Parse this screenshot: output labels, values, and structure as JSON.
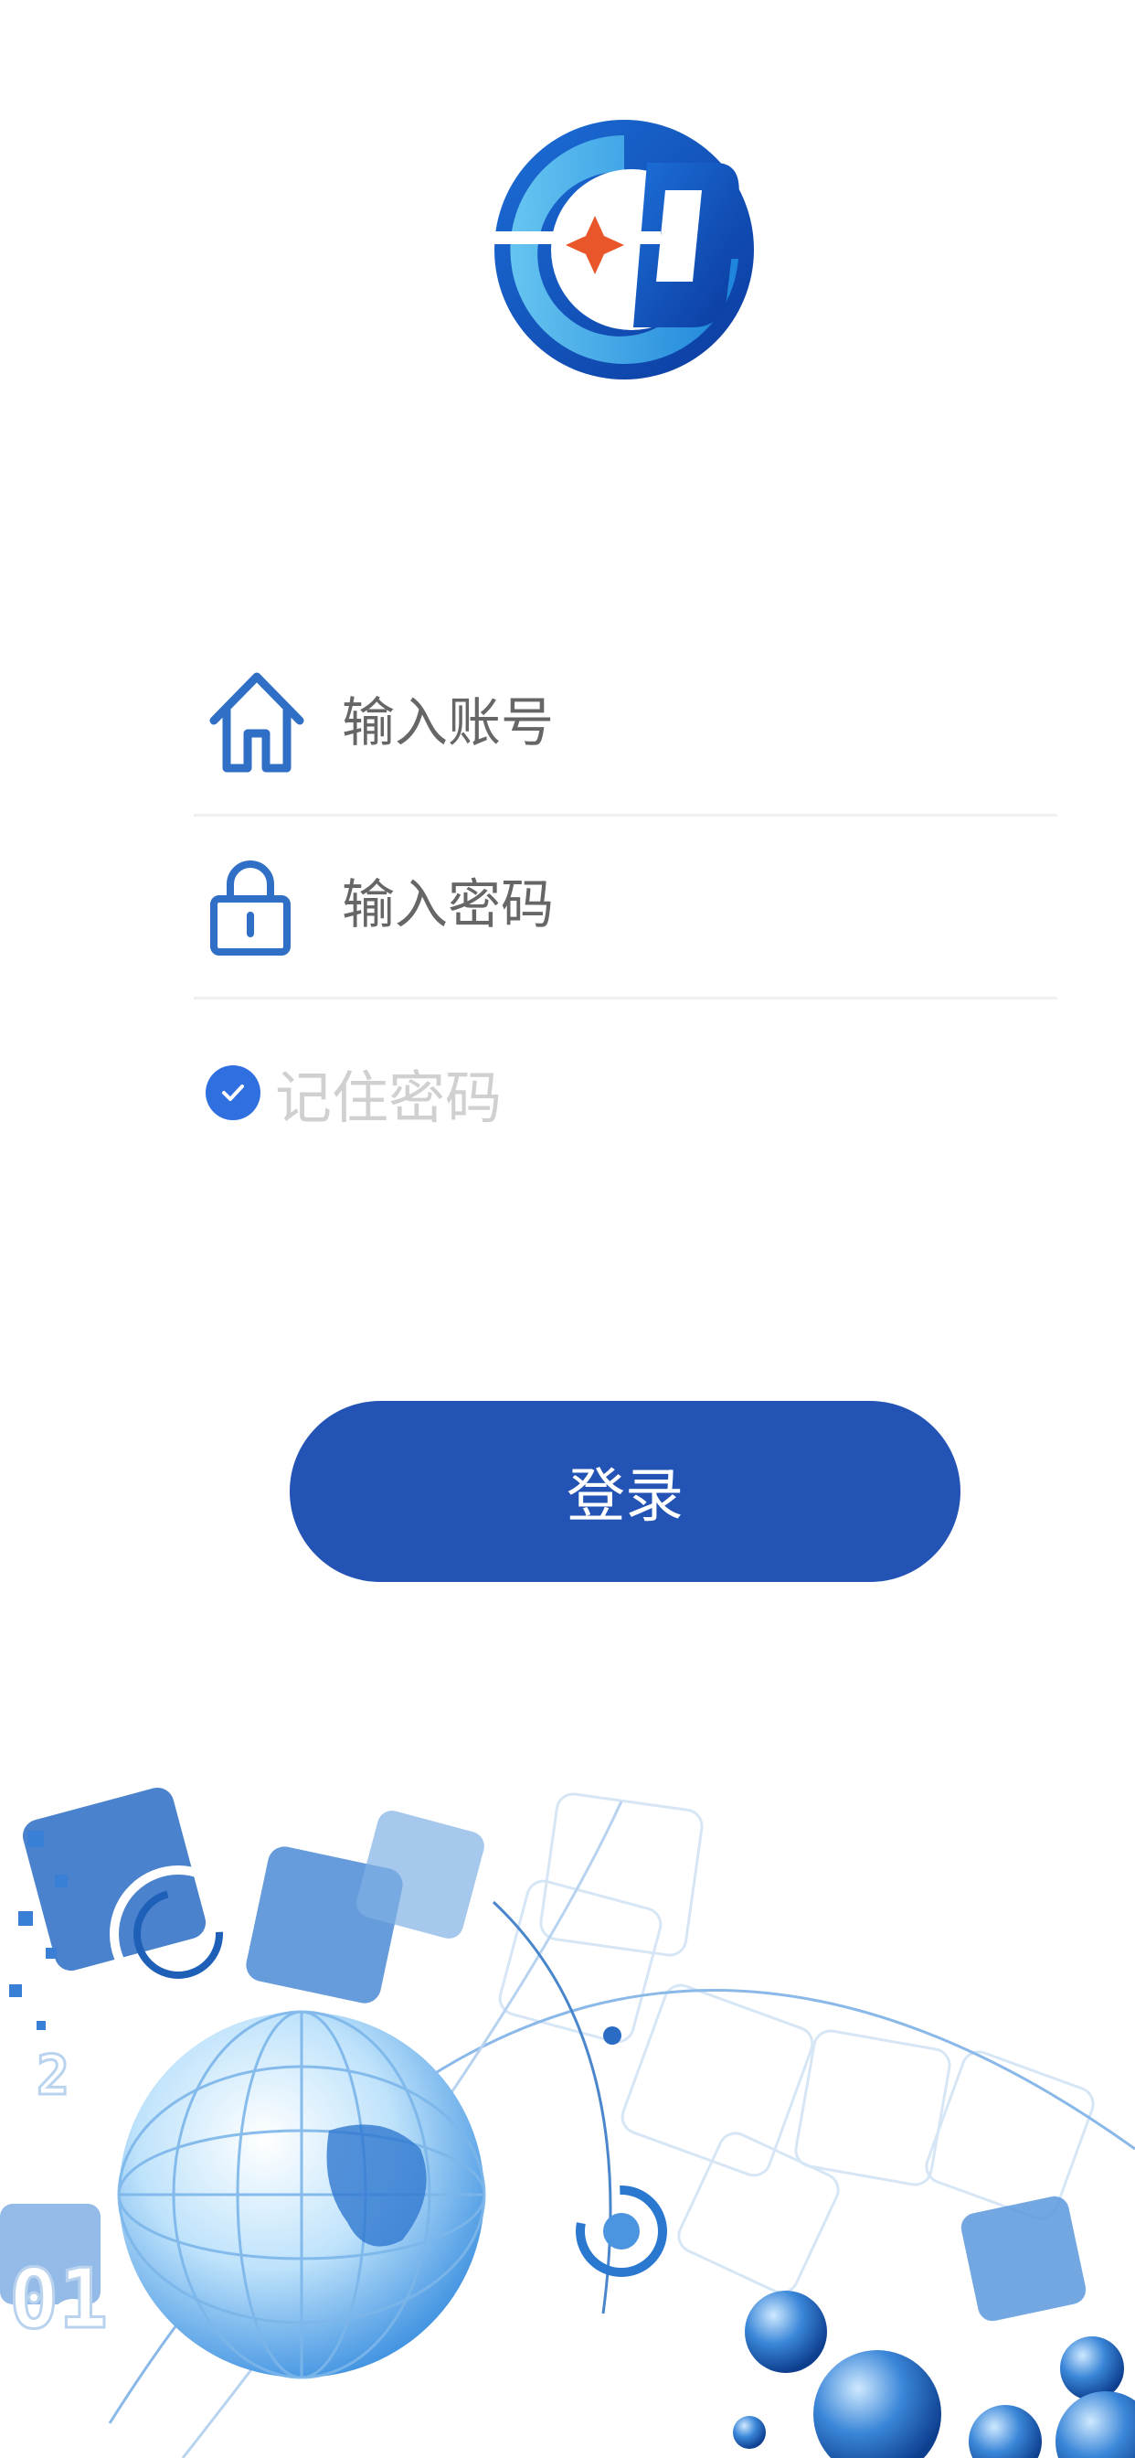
{
  "form": {
    "account_placeholder": "输入账号",
    "password_placeholder": "输入密码",
    "remember_label": "记住密码",
    "remember_checked": true
  },
  "login_button_label": "登录",
  "icons": {
    "account": "home-icon",
    "password": "lock-icon",
    "remember": "check-icon"
  },
  "colors": {
    "primary": "#2353b5",
    "icon_blue": "#2f6fc6",
    "checkbox": "#2f6fe0",
    "placeholder": "#666666",
    "remember_text": "#d0d0d0",
    "divider": "#f0f0f0"
  }
}
